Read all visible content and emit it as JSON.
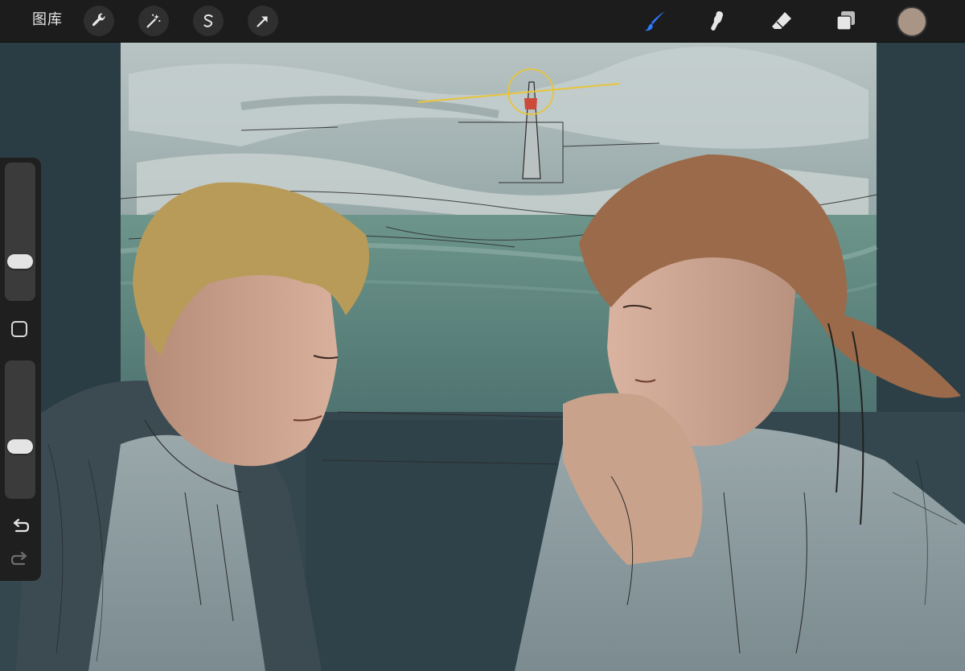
{
  "toolbar": {
    "gallery_label": "图库",
    "left_tools": [
      {
        "name": "actions",
        "icon": "wrench-icon"
      },
      {
        "name": "adjustments",
        "icon": "magic-wand-icon"
      },
      {
        "name": "selection",
        "icon": "selection-s-icon"
      },
      {
        "name": "transform",
        "icon": "arrow-cursor-icon"
      }
    ],
    "right_tools": [
      {
        "name": "brush",
        "icon": "brush-icon",
        "active": true,
        "color": "#2f7bff"
      },
      {
        "name": "smudge",
        "icon": "smudge-finger-icon",
        "active": false
      },
      {
        "name": "eraser",
        "icon": "eraser-icon",
        "active": false
      },
      {
        "name": "layers",
        "icon": "layers-icon",
        "active": false
      }
    ],
    "current_color": "#a89585"
  },
  "sidebar": {
    "brush_size_icon": "size-slider",
    "opacity_icon": "opacity-slider",
    "modify_icon": "square-modify-icon",
    "undo_icon": "undo-arrow-icon",
    "redo_icon": "redo-arrow-icon",
    "brush_size_level": 0.25,
    "opacity_level": 0.36
  },
  "canvas": {
    "palette": {
      "sky": "#a8b5b4",
      "sea": "#5f8a80",
      "frame": "#2e4047",
      "skin": "#c9a089",
      "blond_hair": "#b79d5a",
      "brown_hair": "#9a6a4a",
      "shirt": "#8a989c"
    }
  }
}
